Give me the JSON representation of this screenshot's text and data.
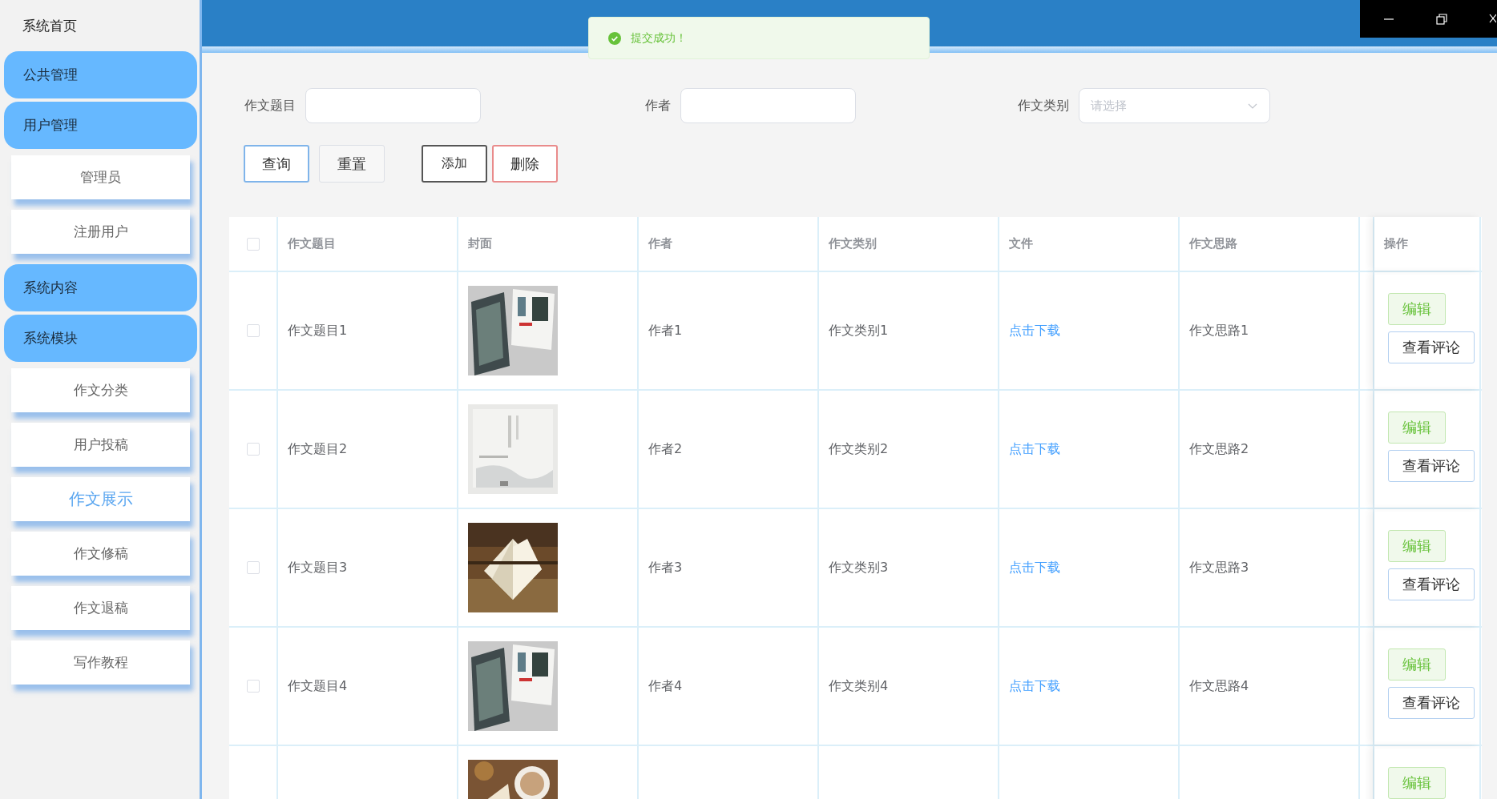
{
  "sidebar": {
    "home": "系统首页",
    "groups": [
      {
        "label": "公共管理"
      },
      {
        "label": "用户管理",
        "children": [
          {
            "label": "管理员",
            "selected": false
          },
          {
            "label": "注册用户",
            "selected": false
          }
        ]
      },
      {
        "label": "系统内容"
      },
      {
        "label": "系统模块",
        "children": [
          {
            "label": "作文分类",
            "selected": false
          },
          {
            "label": "用户投稿",
            "selected": false
          },
          {
            "label": "作文展示",
            "selected": true
          },
          {
            "label": "作文修稿",
            "selected": false
          },
          {
            "label": "作文退稿",
            "selected": false
          },
          {
            "label": "写作教程",
            "selected": false
          }
        ]
      }
    ]
  },
  "toast": {
    "message": "提交成功！"
  },
  "search": {
    "fields": [
      {
        "label": "作文题目",
        "kind": "input"
      },
      {
        "label": "作者",
        "kind": "input"
      },
      {
        "label": "作文类别",
        "kind": "select",
        "placeholder": "请选择"
      }
    ],
    "buttons": [
      {
        "label": "查询",
        "kind": "primary"
      },
      {
        "label": "重置",
        "kind": "default"
      },
      {
        "label": "添加",
        "kind": "dark"
      },
      {
        "label": "删除",
        "kind": "danger"
      }
    ]
  },
  "table": {
    "header_checked": false,
    "columns": [
      "作文题目",
      "封面",
      "作者",
      "作文类别",
      "文件",
      "作文思路"
    ],
    "action_column": "操作",
    "rows": [
      {
        "checked": false,
        "title": "作文题目1",
        "cover": {
          "kind": "picture"
        },
        "author": "作者1",
        "category": "作文类别1",
        "file": "点击下载",
        "idea": "作文思路1",
        "actions": [
          {
            "label": "编辑",
            "kind": "edit"
          },
          {
            "label": "查看评论",
            "kind": "view"
          }
        ]
      },
      {
        "checked": false,
        "title": "作文题目2",
        "cover": {
          "kind": "picture"
        },
        "author": "作者2",
        "category": "作文类别2",
        "file": "点击下载",
        "idea": "作文思路2",
        "actions": [
          {
            "label": "编辑",
            "kind": "edit"
          },
          {
            "label": "查看评论",
            "kind": "view"
          }
        ]
      },
      {
        "checked": false,
        "title": "作文题目3",
        "cover": {
          "kind": "picture"
        },
        "author": "作者3",
        "category": "作文类别3",
        "file": "点击下载",
        "idea": "作文思路3",
        "actions": [
          {
            "label": "编辑",
            "kind": "edit"
          },
          {
            "label": "查看评论",
            "kind": "view"
          }
        ]
      },
      {
        "checked": false,
        "title": "作文题目4",
        "cover": {
          "kind": "picture"
        },
        "author": "作者4",
        "category": "作文类别4",
        "file": "点击下载",
        "idea": "作文思路4",
        "actions": [
          {
            "label": "编辑",
            "kind": "edit"
          },
          {
            "label": "查看评论",
            "kind": "view"
          }
        ]
      },
      {
        "cover": {
          "kind": "picture"
        },
        "actions": [
          {
            "label": "编辑",
            "kind": "edit"
          }
        ]
      }
    ]
  }
}
